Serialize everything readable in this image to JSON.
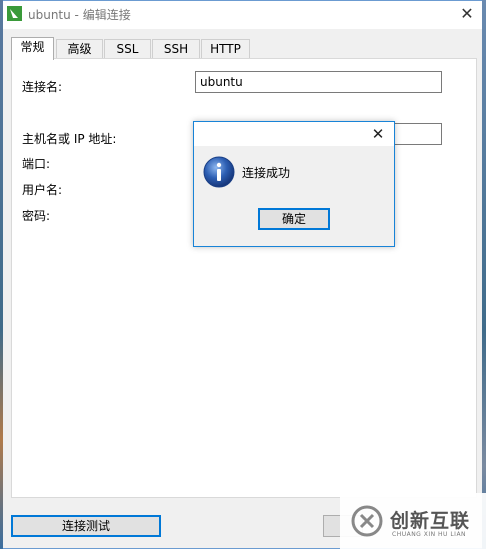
{
  "window": {
    "title": "ubuntu - 编辑连接",
    "close_glyph": "✕"
  },
  "tabs": [
    {
      "label": "常规",
      "active": true
    },
    {
      "label": "高级",
      "active": false
    },
    {
      "label": "SSL",
      "active": false
    },
    {
      "label": "SSH",
      "active": false
    },
    {
      "label": "HTTP",
      "active": false
    }
  ],
  "form": {
    "connection_name_label": "连接名:",
    "connection_name_value": "ubuntu",
    "host_label": "主机名或 IP 地址:",
    "host_value": "",
    "port_label": "端口:",
    "username_label": "用户名:",
    "password_label": "密码:"
  },
  "buttons": {
    "test_connection": "连接测试"
  },
  "dialog": {
    "message": "连接成功",
    "ok_label": "确定",
    "close_glyph": "✕"
  },
  "watermark": {
    "name": "创新互联",
    "subtitle": "CHUANG XIN HU LIAN"
  },
  "colors": {
    "accent": "#0078d7",
    "app_icon": "#3a9a3a",
    "info_icon": "#2d5fb3"
  }
}
